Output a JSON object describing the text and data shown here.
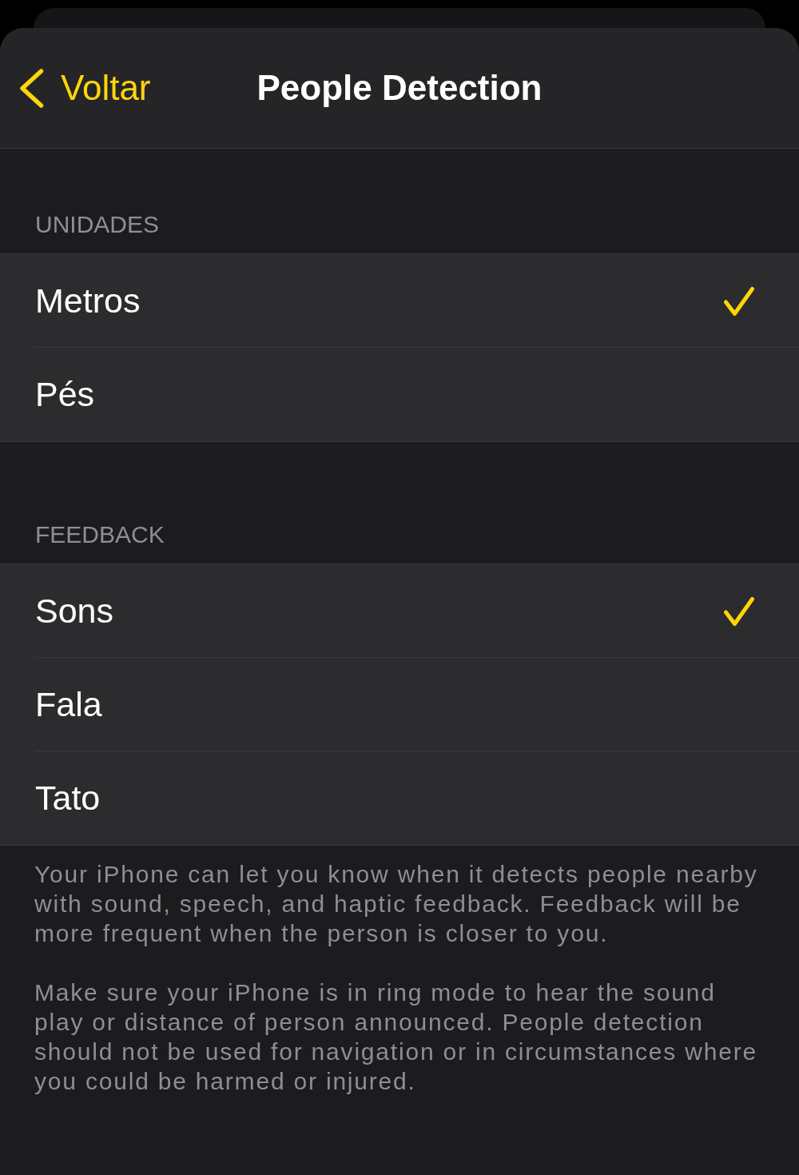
{
  "nav": {
    "back_label": "Voltar",
    "title": "People Detection"
  },
  "sections": [
    {
      "header": "UNIDADES",
      "items": [
        {
          "label": "Metros",
          "selected": true
        },
        {
          "label": "Pés",
          "selected": false
        }
      ]
    },
    {
      "header": "FEEDBACK",
      "items": [
        {
          "label": "Sons",
          "selected": true
        },
        {
          "label": "Fala",
          "selected": false
        },
        {
          "label": "Tato",
          "selected": false
        }
      ]
    }
  ],
  "footer": [
    "Your iPhone can let you know when it detects people nearby with sound, speech, and haptic feedback. Feedback will be more frequent when the person is closer to you.",
    "Make sure your iPhone is in ring mode to hear the sound play or distance of person announced. People detection should not be used for navigation or in circumstances where you could be harmed or injured."
  ]
}
